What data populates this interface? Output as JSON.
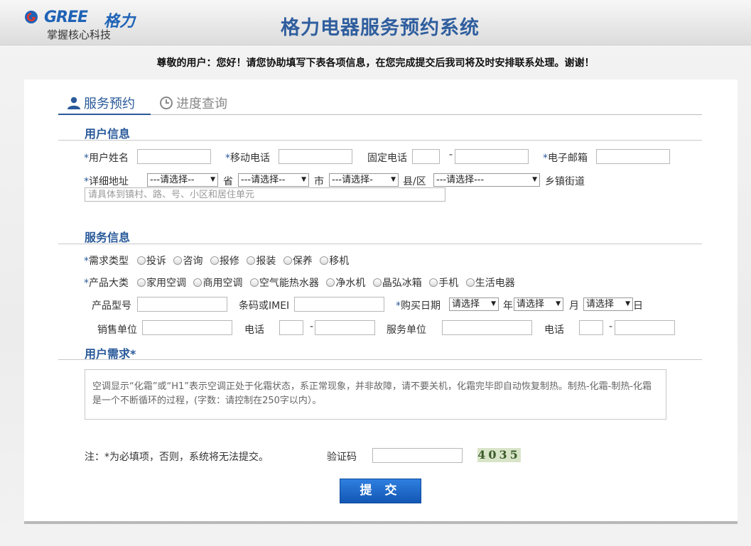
{
  "header": {
    "brand_text": "GREE",
    "brand_cn": "格力",
    "slogan": "掌握核心科技",
    "title": "格力电器服务预约系统"
  },
  "notice": "尊敬的用户：您好！请您协助填写下表各项信息，在您完成提交后我司将及时安排联系处理。谢谢！",
  "tabs": {
    "booking": "服务预约",
    "progress": "进度查询"
  },
  "sections": {
    "user_info": "用户信息",
    "service_info": "服务信息",
    "user_needs": "用户需求*"
  },
  "user_form": {
    "star": "*",
    "name_label": "用户姓名",
    "mobile_label": "移动电话",
    "landline_label": "固定电话",
    "landline_dash": "-",
    "email_label": "电子邮箱",
    "address_label": "详细地址",
    "province_select": "---请选择--",
    "province_unit": "省",
    "city_select": "---请选择--",
    "city_unit": "市",
    "county_select": "---请选择-",
    "county_unit": "县/区",
    "town_select": "---请选择---",
    "town_unit": "乡镇街道",
    "address_placeholder": "请具体到镇村、路、号、小区和居住单元"
  },
  "service_form": {
    "demand_label": "需求类型",
    "demand_options": [
      "投诉",
      "咨询",
      "报修",
      "报装",
      "保养",
      "移机"
    ],
    "category_label": "产品大类",
    "category_options": [
      "家用空调",
      "商用空调",
      "空气能热水器",
      "净水机",
      "晶弘冰箱",
      "手机",
      "生活电器"
    ],
    "model_label": "产品型号",
    "barcode_label": "条码或IMEI",
    "purchase_date_label": "购买日期",
    "year_select": "请选择",
    "year_unit": "年",
    "month_select": "请选择",
    "month_unit": "月",
    "day_select": "请选择",
    "day_unit": "日",
    "seller_label": "销售单位",
    "seller_phone_label": "电话",
    "service_unit_label": "服务单位",
    "service_phone_label": "电话",
    "dash": "-"
  },
  "needs": {
    "placeholder": "空调显示“化霜”或“H1”表示空调正处于化霜状态，系正常现象，并非故障，请不要关机，化霜完毕即自动恢复制热。制热-化霜-制热-化霜是一个不断循环的过程，(字数：请控制在250字以内）。"
  },
  "footer": {
    "note": "注：*为必填项，否则，系统将无法提交。",
    "captcha_label": "验证码",
    "captcha_value": "4035",
    "submit_label": "提 交"
  },
  "colors": {
    "accent": "#2a5a9a",
    "submit": "#1a64c4"
  }
}
